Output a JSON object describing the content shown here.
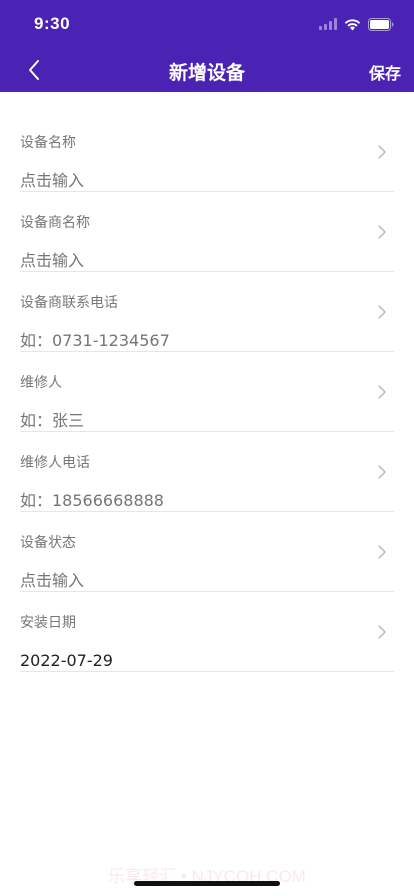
{
  "status_bar": {
    "time": "9:30"
  },
  "nav": {
    "title": "新增设备",
    "save_label": "保存",
    "back_icon": "chevron-left-icon"
  },
  "form": {
    "fields": [
      {
        "label": "设备名称",
        "value": "",
        "placeholder": "点击输入"
      },
      {
        "label": "设备商名称",
        "value": "",
        "placeholder": "点击输入"
      },
      {
        "label": "设备商联系电话",
        "value": "",
        "placeholder": "如：0731-1234567"
      },
      {
        "label": "维修人",
        "value": "",
        "placeholder": "如：张三"
      },
      {
        "label": "维修人电话",
        "value": "",
        "placeholder": "如：18566668888"
      },
      {
        "label": "设备状态",
        "value": "",
        "placeholder": "点击输入"
      },
      {
        "label": "安装日期",
        "value": "2022-07-29",
        "placeholder": ""
      }
    ]
  },
  "watermark": "乐享轻汇 • NJYCQH.COM",
  "colors": {
    "header_bg": "#4a22b4",
    "label": "#777777",
    "placeholder": "#bdbdbd",
    "value": "#222222",
    "divider": "#e6e6e6"
  }
}
